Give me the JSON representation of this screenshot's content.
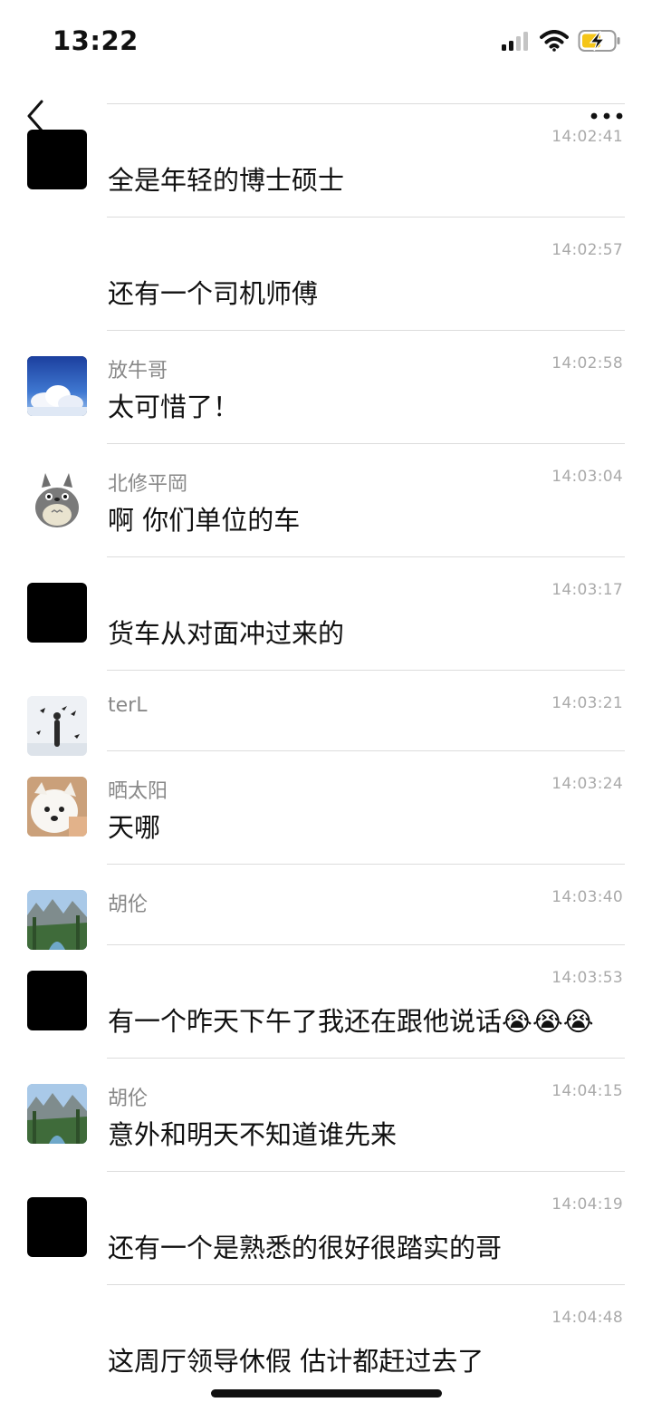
{
  "status_bar": {
    "time": "13:22",
    "icons": [
      "cellular-signal-icon",
      "wifi-icon",
      "battery-charging-icon"
    ]
  },
  "header": {
    "back_icon": "chevron-left-icon",
    "more_icon": "more-dots-icon"
  },
  "messages": [
    {
      "sender": "",
      "time": "14:02:41",
      "text": "全是年轻的博士硕士",
      "avatar": "black"
    },
    {
      "sender": "",
      "time": "14:02:57",
      "text": "还有一个司机师傅",
      "avatar": "none"
    },
    {
      "sender": "放牛哥",
      "time": "14:02:58",
      "text": "太可惜了！",
      "avatar": "sky"
    },
    {
      "sender": "北修平岡",
      "time": "14:03:04",
      "text": "啊 你们单位的车",
      "avatar": "totoro"
    },
    {
      "sender": "",
      "time": "14:03:17",
      "text": "货车从对面冲过来的",
      "avatar": "black"
    },
    {
      "sender": "terL",
      "time": "14:03:21",
      "text": "",
      "avatar": "birds"
    },
    {
      "sender": "晒太阳",
      "time": "14:03:24",
      "text": "天哪",
      "avatar": "dog"
    },
    {
      "sender": "胡伦",
      "time": "14:03:40",
      "text": "",
      "avatar": "landscape"
    },
    {
      "sender": "",
      "time": "14:03:53",
      "text": "有一个昨天下午了我还在跟他说话😭😭😭",
      "avatar": "black"
    },
    {
      "sender": "胡伦",
      "time": "14:04:15",
      "text": "意外和明天不知道谁先来",
      "avatar": "landscape"
    },
    {
      "sender": "",
      "time": "14:04:19",
      "text": "还有一个是熟悉的很好很踏实的哥",
      "avatar": "black"
    },
    {
      "sender": "",
      "time": "14:04:48",
      "text": "这周厅领导休假 估计都赶过去了",
      "avatar": "none"
    }
  ],
  "colors": {
    "background": "#ffffff",
    "text": "#111111",
    "sender": "#888888",
    "timestamp": "#aaaaaa",
    "divider": "#dcdcdc",
    "battery": "#f5c518"
  }
}
